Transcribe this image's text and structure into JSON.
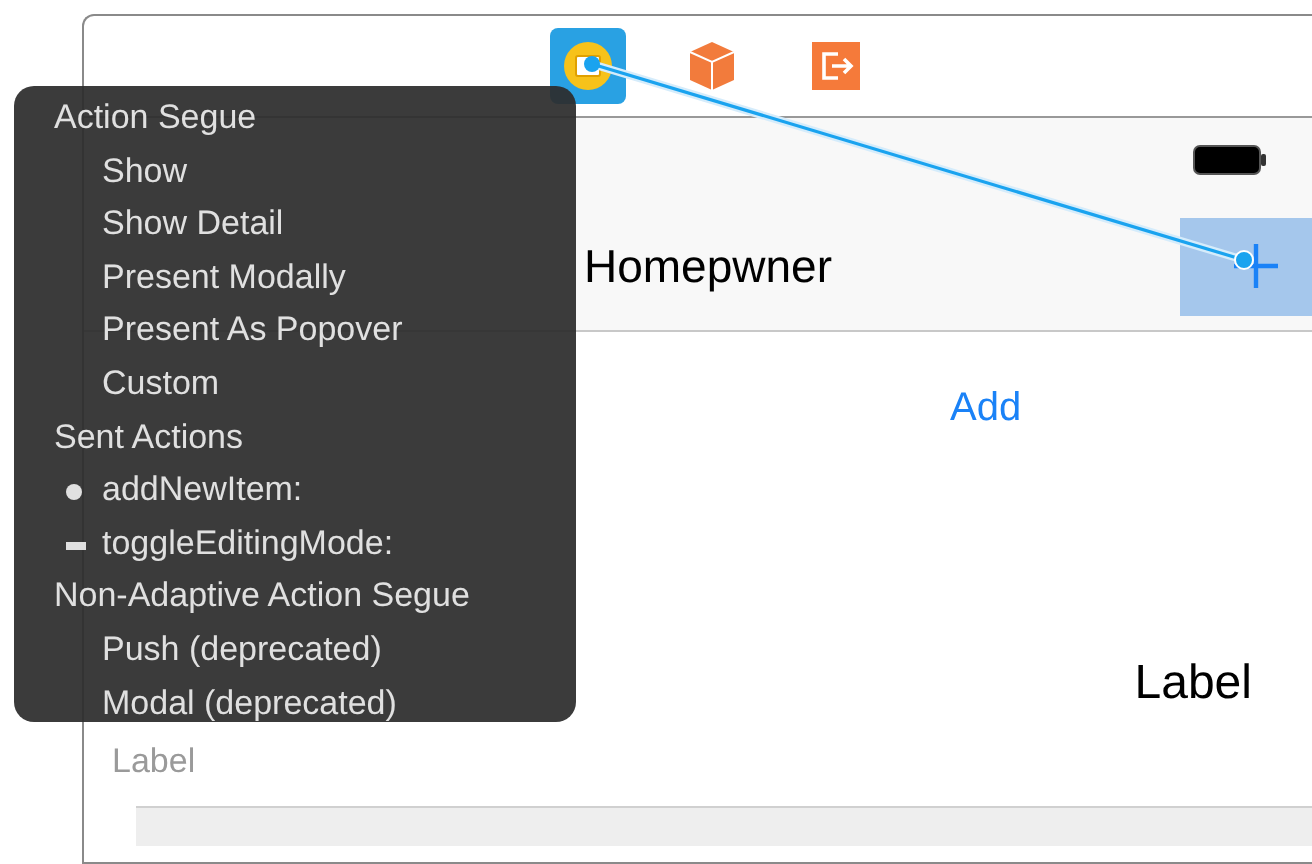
{
  "dock": {
    "icons": [
      {
        "kind": "view-controller",
        "selected": true
      },
      {
        "kind": "first-responder",
        "selected": false
      },
      {
        "kind": "exit",
        "selected": false
      }
    ]
  },
  "navigation_bar": {
    "title": "Homepwner",
    "add_button": {
      "highlighted": true
    }
  },
  "content": {
    "add_button": "Add",
    "cell_label": "Label",
    "subtitle_label": "Label"
  },
  "connection_menu": {
    "sections": [
      {
        "title": "Action Segue",
        "items": [
          {
            "label": "Show"
          },
          {
            "label": "Show Detail"
          },
          {
            "label": "Present Modally"
          },
          {
            "label": "Present As Popover"
          },
          {
            "label": "Custom"
          }
        ]
      },
      {
        "title": "Sent Actions",
        "items": [
          {
            "label": "addNewItem:",
            "kind": "connected"
          },
          {
            "label": "toggleEditingMode:",
            "kind": "unconnected"
          }
        ]
      },
      {
        "title": "Non-Adaptive Action Segue",
        "items": [
          {
            "label": "Push (deprecated)"
          },
          {
            "label": "Modal (deprecated)"
          }
        ]
      }
    ]
  }
}
